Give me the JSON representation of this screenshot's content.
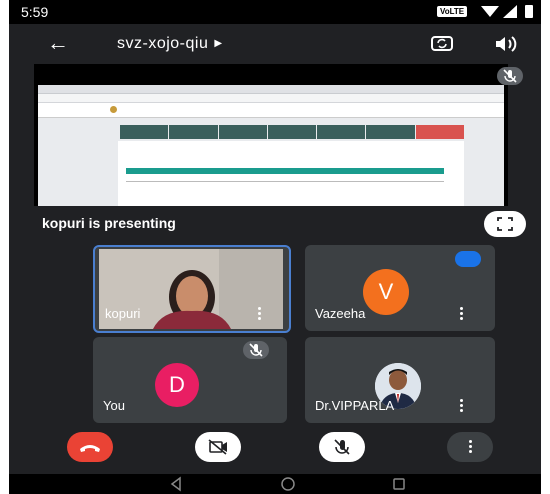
{
  "status_bar": {
    "time": "5:59",
    "network_badge": "VoLTE"
  },
  "meeting": {
    "title": "svz-xojo-qiu",
    "presenting_text": "kopuri is presenting"
  },
  "participants": [
    {
      "name": "kopuri",
      "tile": "video"
    },
    {
      "name": "Vazeeha",
      "avatar_letter": "V",
      "avatar_color": "#f3701e"
    },
    {
      "name": "You",
      "avatar_letter": "D",
      "avatar_color": "#e91e63"
    },
    {
      "name": "Dr.VIPPARLA",
      "tile": "photo"
    }
  ],
  "icons": [
    "back-arrow-icon",
    "caret-icon",
    "switch-camera-icon",
    "speaker-icon",
    "mic-off-icon",
    "fullscreen-icon",
    "more-vert-icon",
    "end-call-icon",
    "camera-off-icon"
  ],
  "colors": {
    "end_call": "#ea4335",
    "tile_bg": "#3c4043",
    "active_border": "#4a7fd0"
  }
}
